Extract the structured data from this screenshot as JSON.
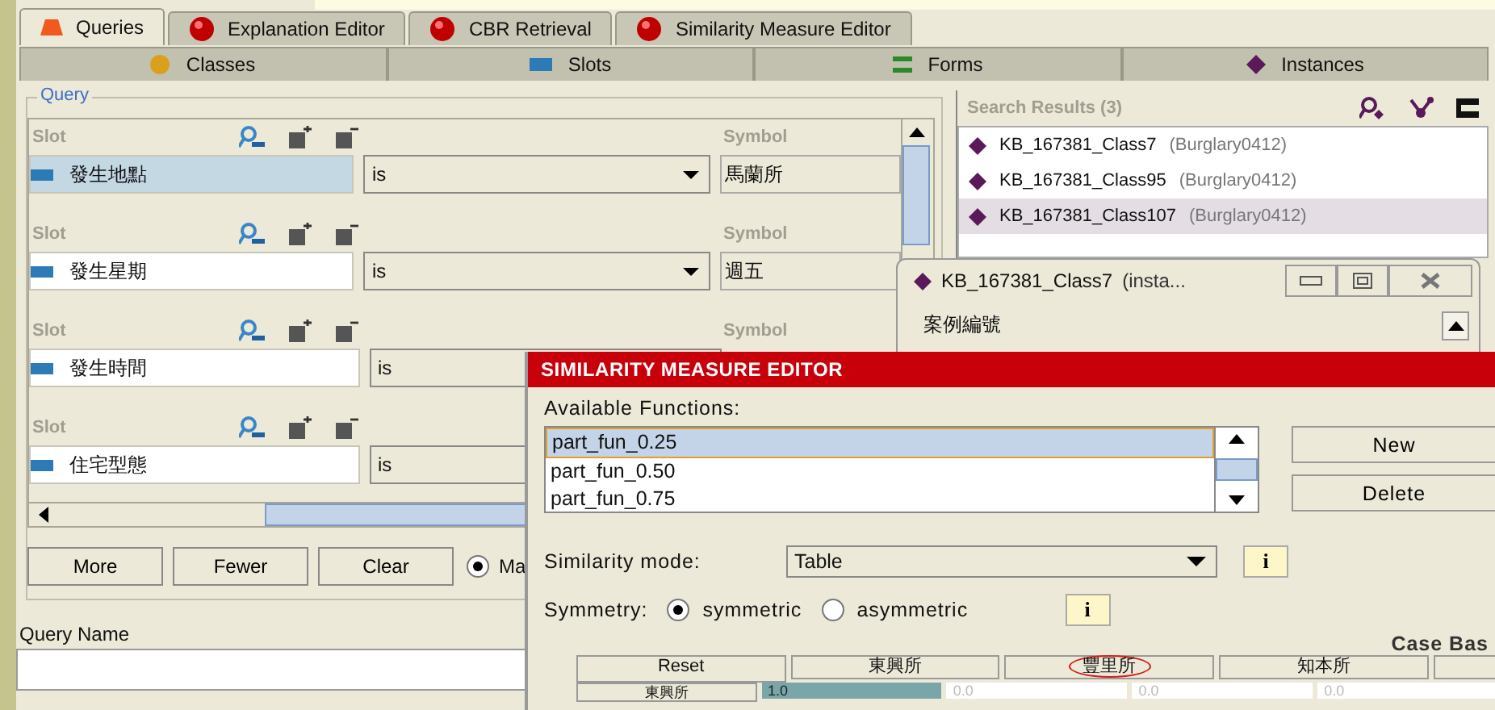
{
  "main_tabs": [
    {
      "label": "Queries",
      "selected": true
    },
    {
      "label": "Explanation Editor",
      "selected": false
    },
    {
      "label": "CBR Retrieval",
      "selected": false
    },
    {
      "label": "Similarity Measure Editor",
      "selected": false
    }
  ],
  "sub_tabs": [
    {
      "label": "Classes"
    },
    {
      "label": "Slots"
    },
    {
      "label": "Forms"
    },
    {
      "label": "Instances"
    }
  ],
  "query": {
    "legend": "Query",
    "slots": [
      {
        "slot_label": "Slot",
        "symbol_label": "Symbol",
        "name": "發生地點",
        "operator": "is",
        "arrow": true,
        "value": "馬蘭所",
        "selected": true
      },
      {
        "slot_label": "Slot",
        "symbol_label": "Symbol",
        "name": "發生星期",
        "operator": "is",
        "arrow": true,
        "value": "週五",
        "selected": false
      },
      {
        "slot_label": "Slot",
        "symbol_label": "Symbol",
        "name": "發生時間",
        "operator": "is",
        "selected": false
      },
      {
        "slot_label": "Slot",
        "name": "住宅型態",
        "operator": "is",
        "selected": false
      }
    ],
    "buttons": [
      "More",
      "Fewer",
      "Clear"
    ],
    "match_option": {
      "label": "Ma",
      "selected": true
    },
    "name_label": "Query Name"
  },
  "search_results": {
    "title": "Search Results (3)",
    "items": [
      {
        "name": "KB_167381_Class7",
        "type": "(Burglary0412)",
        "selected": false
      },
      {
        "name": "KB_167381_Class95",
        "type": "(Burglary0412)",
        "selected": false
      },
      {
        "name": "KB_167381_Class107",
        "type": "(Burglary0412)",
        "selected": true
      }
    ]
  },
  "instance_window": {
    "title": "KB_167381_Class7",
    "subtitle": "(insta...",
    "field_label": "案例編號"
  },
  "similarity_editor": {
    "title": "SIMILARITY MEASURE EDITOR",
    "functions_label": "Available Functions:",
    "functions": [
      {
        "label": "part_fun_0.25",
        "selected": true
      },
      {
        "label": "part_fun_0.50",
        "selected": false
      },
      {
        "label": "part_fun_0.75",
        "selected": false
      }
    ],
    "buttons": [
      "New",
      "Delete"
    ],
    "mode_label": "Similarity mode:",
    "mode": "Table",
    "mode_info": "i",
    "symmetry_label": "Symmetry:",
    "symmetry": [
      {
        "label": "symmetric",
        "selected": true
      },
      {
        "label": "asymmetric",
        "selected": false
      }
    ],
    "symmetry_info": "i",
    "case_base_label": "Case Bas",
    "table": {
      "columns": [
        {
          "label": "Reset",
          "circled": false
        },
        {
          "label": "東興所",
          "circled": false
        },
        {
          "label": "豐里所",
          "circled": true
        },
        {
          "label": "知本所",
          "circled": false
        }
      ],
      "rows": [
        {
          "label": "東興所",
          "cells": [
            {
              "text": "1.0",
              "selected": true
            },
            {
              "text": "0.0",
              "selected": false
            },
            {
              "text": "0.0",
              "selected": false
            },
            {
              "text": "0.0",
              "selected": false
            }
          ]
        }
      ]
    }
  }
}
